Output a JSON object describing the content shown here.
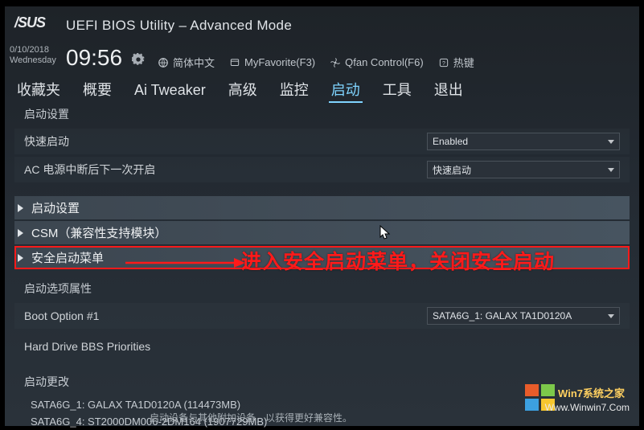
{
  "brand": "/SUS",
  "app_title": "UEFI BIOS Utility – Advanced Mode",
  "date": "0/10/2018",
  "weekday": "Wednesday",
  "time": "09:56",
  "topbar": {
    "lang": "简体中文",
    "fav": "MyFavorite(F3)",
    "qfan": "Qfan Control(F6)",
    "hotkey": "热键"
  },
  "menu": {
    "items": [
      "收藏夹",
      "概要",
      "Ai Tweaker",
      "高级",
      "监控",
      "启动",
      "工具",
      "退出"
    ],
    "active_index": 5
  },
  "boot": {
    "section1_title": "启动设置",
    "fastboot_label": "快速启动",
    "fastboot_value": "Enabled",
    "acpower_label": "AC 电源中断后下一次开启",
    "acpower_value": "快速启动",
    "exp1": "启动设置",
    "exp2": "CSM（兼容性支持模块）",
    "exp3": "安全启动菜单",
    "section2_title": "启动选项属性",
    "bootopt_label": "Boot Option #1",
    "bootopt_value": "SATA6G_1: GALAX TA1D0120A",
    "hddbbs": "Hard Drive BBS Priorities",
    "section3_title": "启动更改",
    "drive1": "SATA6G_1: GALAX TA1D0120A  (114473MB)",
    "drive2": "SATA6G_4: ST2000DM006-2DM164  (1907729MB)",
    "footer_hint": "启动设备与其他附加设备，以获得更好兼容性。"
  },
  "annotation": "进入安全启动菜单，关闭安全启动",
  "watermark": {
    "brand": "Win7系统之家",
    "url": "Www.Winwin7.Com"
  }
}
